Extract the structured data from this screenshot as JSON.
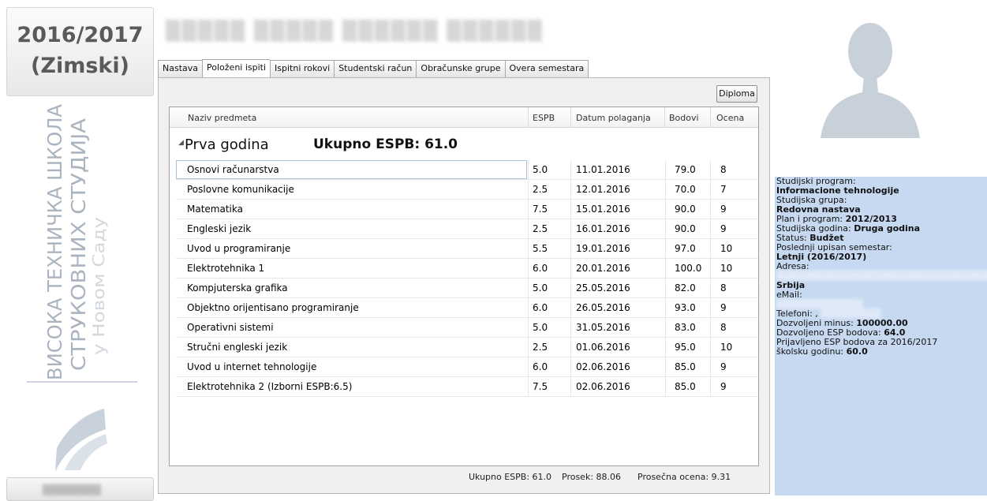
{
  "sidebar": {
    "year": "2016/2017",
    "semester": "(Zimski)",
    "school_line1": "ВИСОКА ТЕХНИЧКА ШКОЛА",
    "school_line2": "СТРУКОВНИХ СТУДИЈА",
    "school_line3": "у Новом Саду"
  },
  "tabs": [
    {
      "label": "Nastava"
    },
    {
      "label": "Položeni ispiti"
    },
    {
      "label": "Ispitni rokovi"
    },
    {
      "label": "Studentski račun"
    },
    {
      "label": "Obračunske grupe"
    },
    {
      "label": "Overa semestara"
    }
  ],
  "active_tab": "Položeni ispiti",
  "toolbar": {
    "diploma_label": "Diploma"
  },
  "grid": {
    "columns": [
      "Naziv predmeta",
      "ESPB",
      "Datum polaganja",
      "Bodovi",
      "Ocena"
    ],
    "group": {
      "title": "Prva godina",
      "total": "Ukupno ESPB: 61.0"
    },
    "rows": [
      {
        "name": "Osnovi računarstva",
        "espb": "5.0",
        "date": "11.01.2016",
        "points": "79.0",
        "grade": "8"
      },
      {
        "name": "Poslovne komunikacije",
        "espb": "2.5",
        "date": "12.01.2016",
        "points": "70.0",
        "grade": "7"
      },
      {
        "name": "Matematika",
        "espb": "7.5",
        "date": "15.01.2016",
        "points": "90.0",
        "grade": "9"
      },
      {
        "name": "Engleski jezik",
        "espb": "2.5",
        "date": "16.01.2016",
        "points": "90.0",
        "grade": "9"
      },
      {
        "name": "Uvod u programiranje",
        "espb": "5.5",
        "date": "19.01.2016",
        "points": "97.0",
        "grade": "10"
      },
      {
        "name": "Elektrotehnika 1",
        "espb": "6.0",
        "date": "20.01.2016",
        "points": "100.0",
        "grade": "10"
      },
      {
        "name": "Kompjuterska grafika",
        "espb": "5.0",
        "date": "25.05.2016",
        "points": "82.0",
        "grade": "8"
      },
      {
        "name": "Objektno orijentisano programiranje",
        "espb": "6.0",
        "date": "26.05.2016",
        "points": "93.0",
        "grade": "9"
      },
      {
        "name": "Operativni sistemi",
        "espb": "5.0",
        "date": "31.05.2016",
        "points": "83.0",
        "grade": "8"
      },
      {
        "name": "Stručni engleski jezik",
        "espb": "2.5",
        "date": "01.06.2016",
        "points": "95.0",
        "grade": "10"
      },
      {
        "name": "Uvod u internet tehnologije",
        "espb": "6.0",
        "date": "02.06.2016",
        "points": "85.0",
        "grade": "9"
      },
      {
        "name": "Elektrotehnika 2 (Izborni ESPB:6.5)",
        "espb": "7.5",
        "date": "02.06.2016",
        "points": "85.0",
        "grade": "9"
      }
    ]
  },
  "footer": {
    "total_espb": "Ukupno ESPB: 61.0",
    "average": "Prosek: 88.06",
    "avg_grade": "Prosečna ocena: 9.31"
  },
  "info": {
    "program_label": "Studijski program:",
    "program": "Informacione tehnologije",
    "group_label": "Studijska grupa:",
    "group": "Redovna nastava",
    "plan_label": "Plan i program: ",
    "plan": "2012/2013",
    "year_label": "Studijska godina: ",
    "year": "Druga godina",
    "status_label": "Status: ",
    "status": "Budžet",
    "last_sem_label": "Poslednji upisan semestar:",
    "last_sem": "Letnji (2016/2017)",
    "address_label": "Adresa:",
    "country": "Srbija",
    "email_label": "eMail:",
    "phone_label": "Telefoni: ,",
    "minus_label": "Dozvoljeni minus: ",
    "minus": "100000.00",
    "esp_allowed_label": "Dozvoljeno ESP bodova: ",
    "esp_allowed": "64.0",
    "esp_applied_label": "Prijavljeno ESP bodova za  2016/2017",
    "esp_applied_label2": "školsku godinu: ",
    "esp_applied": "60.0"
  }
}
